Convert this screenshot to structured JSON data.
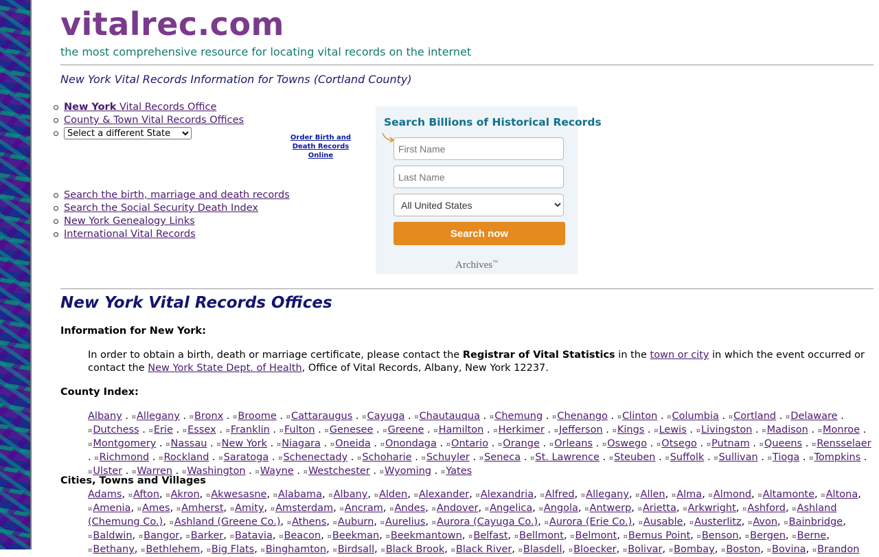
{
  "site": {
    "title": "vitalrec.com",
    "tagline": "the most comprehensive resource for locating vital records on the internet"
  },
  "page_heading": "New York Vital Records Information for Towns (Cortland County)",
  "top_links": {
    "office_link_bold": "New York",
    "office_link_rest": " Vital Records Office",
    "county_town_link": "County & Town Vital Records Offices",
    "state_select": "Select a different State"
  },
  "order_link": {
    "line1": "Order Birth and",
    "line2": "Death Records Online"
  },
  "bottom_links": [
    "Search the birth, marriage and death records",
    "Search the Social Security Death Index",
    "New York Genealogy Links",
    "International Vital Records"
  ],
  "search_widget": {
    "title": "Search Billions of Historical Records",
    "first_name_placeholder": "First Name",
    "last_name_placeholder": "Last Name",
    "location_option": "All United States",
    "button_label": "Search now",
    "logo": "Archives",
    "logo_mark": "™"
  },
  "offices": {
    "heading": "New York Vital Records Offices",
    "info_label": "Information for New York:",
    "para_1": "In order to obtain a birth, death or marriage certificate, please contact the ",
    "para_bold": "Registrar of Vital Statistics",
    "para_2": " in the ",
    "para_link1": "town or city",
    "para_3": " in which the event occurred or contact the ",
    "para_link2": "New York State Dept. of Health",
    "para_4": ", Office of Vital Records, Albany, New York 12237.",
    "county_label": "County Index:",
    "cities_label": "Cities, Towns and Villages"
  },
  "counties": [
    "Albany",
    "Allegany",
    "Bronx",
    "Broome",
    "Cattaraugus",
    "Cayuga",
    "Chautauqua",
    "Chemung",
    "Chenango",
    "Clinton",
    "Columbia",
    "Cortland",
    "Delaware",
    "Dutchess",
    "Erie",
    "Essex",
    "Franklin",
    "Fulton",
    "Genesee",
    "Greene",
    "Hamilton",
    "Herkimer",
    "Jefferson",
    "Kings",
    "Lewis",
    "Livingston",
    "Madison",
    "Monroe",
    "Montgomery",
    "Nassau",
    "New York",
    "Niagara",
    "Oneida",
    "Onondaga",
    "Ontario",
    "Orange",
    "Orleans",
    "Oswego",
    "Otsego",
    "Putnam",
    "Queens",
    "Rensselaer",
    "Richmond",
    "Rockland",
    "Saratoga",
    "Schenectady",
    "Schoharie",
    "Schuyler",
    "Seneca",
    "St. Lawrence",
    "Steuben",
    "Suffolk",
    "Sullivan",
    "Tioga",
    "Tompkins",
    "Ulster",
    "Warren",
    "Washington",
    "Wayne",
    "Westchester",
    "Wyoming",
    "Yates"
  ],
  "cities": [
    "Adams",
    "Afton",
    "Akron",
    "Akwesasne",
    "Alabama",
    "Albany",
    "Alden",
    "Alexander",
    "Alexandria",
    "Alfred",
    "Allegany",
    "Allen",
    "Alma",
    "Almond",
    "Altamonte",
    "Altona",
    "Amenia",
    "Ames",
    "Amherst",
    "Amity",
    "Amsterdam",
    "Ancram",
    "Andes",
    "Andover",
    "Angelica",
    "Angola",
    "Antwerp",
    "Arietta",
    "Arkwright",
    "Ashford",
    "Ashland (Chemung Co.)",
    "Ashland (Greene Co.)",
    "Athens",
    "Auburn",
    "Aurelius",
    "Aurora (Cayuga Co.)",
    "Aurora (Erie Co.)",
    "Ausable",
    "Austerlitz",
    "Avon",
    "Bainbridge",
    "Baldwin",
    "Bangor",
    "Barker",
    "Batavia",
    "Beacon",
    "Beekman",
    "Beekmantown",
    "Belfast",
    "Bellmont",
    "Belmont",
    "Bemus Point",
    "Benson",
    "Bergen",
    "Berne",
    "Bethany",
    "Bethlehem",
    "Big Flats",
    "Binghamton",
    "Birdsall",
    "Black Brook",
    "Black River",
    "Blasdell",
    "Bloecker",
    "Bolivar",
    "Bombay",
    "Boston",
    "Bovina",
    "Brandon"
  ],
  "index_glyph": "¤"
}
